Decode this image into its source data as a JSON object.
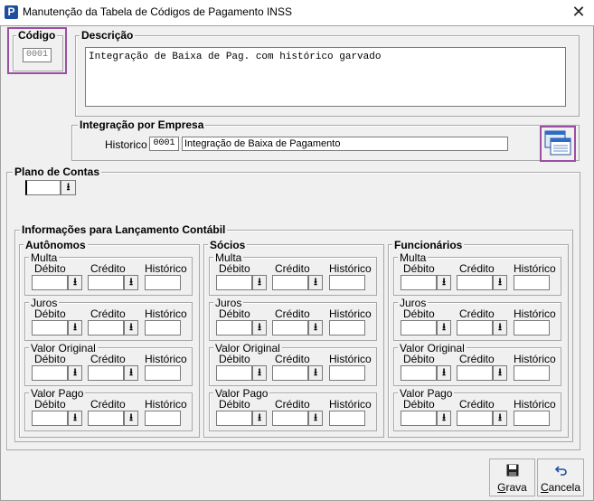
{
  "window": {
    "title": "Manutenção da Tabela de Códigos de Pagamento INSS",
    "app_icon_letter": "P",
    "close_glyph": "✕"
  },
  "codigo": {
    "legend": "Código",
    "value": "0001"
  },
  "descricao": {
    "legend": "Descrição",
    "value": "Integração de Baixa de Pag. com histórico garvado"
  },
  "integracao": {
    "legend": "Integração  por Empresa",
    "historico_label": "Historico",
    "historico_code": "0001",
    "historico_text": "Integração de Baixa de Pagamento"
  },
  "plano": {
    "legend": "Plano de Contas"
  },
  "info": {
    "legend": "Informações para Lançamento Contábil",
    "col_debito": "Débito",
    "col_credito": "Crédito",
    "col_historico": "Histórico",
    "groups": [
      {
        "title": "Autônomos",
        "subs": [
          "Multa",
          "Juros",
          "Valor Original",
          "Valor Pago"
        ]
      },
      {
        "title": "Sócios",
        "subs": [
          "Multa",
          "Juros",
          "Valor Original",
          "Valor Pago"
        ]
      },
      {
        "title": "Funcionários",
        "subs": [
          "Multa",
          "Juros",
          "Valor Original",
          "Valor Pago"
        ]
      }
    ]
  },
  "buttons": {
    "grava": {
      "label": "Grava",
      "mnemonic": "G",
      "rest": "rava",
      "icon": "floppy-disk-icon"
    },
    "cancela": {
      "label": "Cancela",
      "mnemonic": "C",
      "rest": "ancela",
      "icon": "undo-arrow-icon"
    }
  },
  "dropdown_glyph": "⭳"
}
